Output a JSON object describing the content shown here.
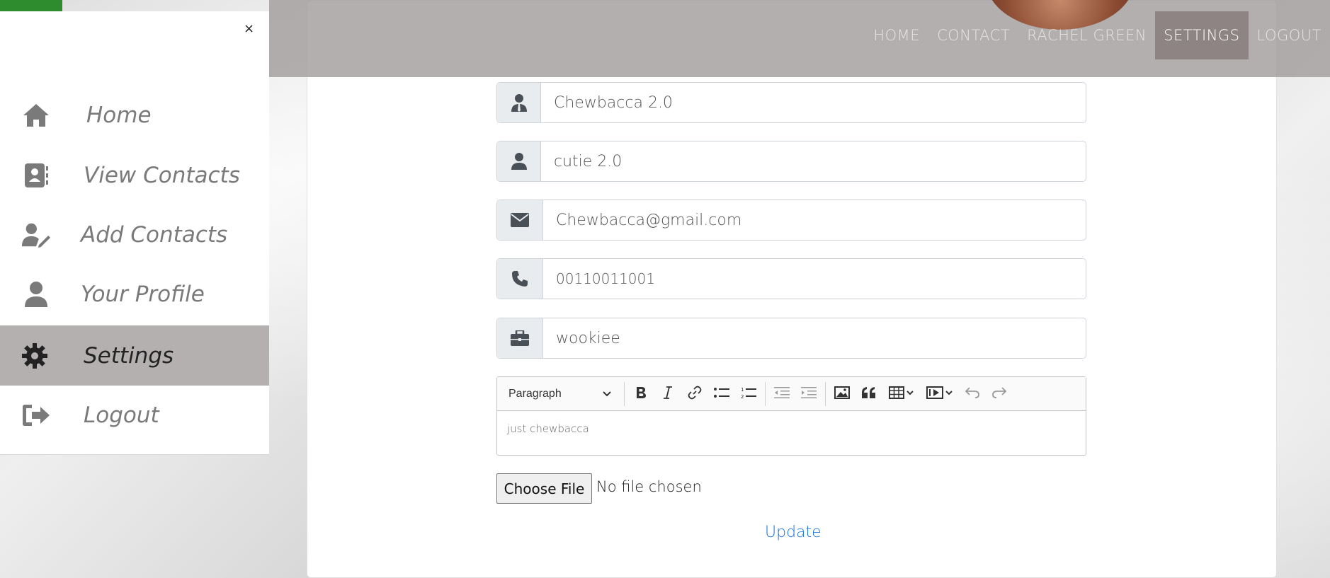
{
  "navbar": {
    "links": [
      "HOME",
      "CONTACT",
      "RACHEL GREEN",
      "SETTINGS",
      "LOGOUT"
    ],
    "active": "SETTINGS"
  },
  "sidebar": {
    "close": "×",
    "items": [
      {
        "label": "Home",
        "icon": "home-icon"
      },
      {
        "label": "View Contacts",
        "icon": "address-book-icon"
      },
      {
        "label": "Add Contacts",
        "icon": "user-edit-icon"
      },
      {
        "label": "Your Profile",
        "icon": "user-icon"
      },
      {
        "label": "Settings",
        "icon": "gear-icon"
      },
      {
        "label": "Logout",
        "icon": "sign-out-icon"
      }
    ],
    "active": "Settings"
  },
  "form": {
    "name": {
      "value": "Chewbacca 2.0",
      "icon": "user-tie-icon"
    },
    "nickname": {
      "value": "cutie 2.0",
      "icon": "user-icon"
    },
    "email": {
      "value": "Chewbacca@gmail.com",
      "icon": "envelope-icon"
    },
    "phone": {
      "value": "00110011001",
      "icon": "phone-icon"
    },
    "work": {
      "value": "wookiee",
      "icon": "briefcase-icon"
    },
    "editor": {
      "format": "Paragraph",
      "content": "just chewbacca"
    },
    "file": {
      "button": "Choose File",
      "status": "No file chosen"
    },
    "submit": "Update"
  }
}
